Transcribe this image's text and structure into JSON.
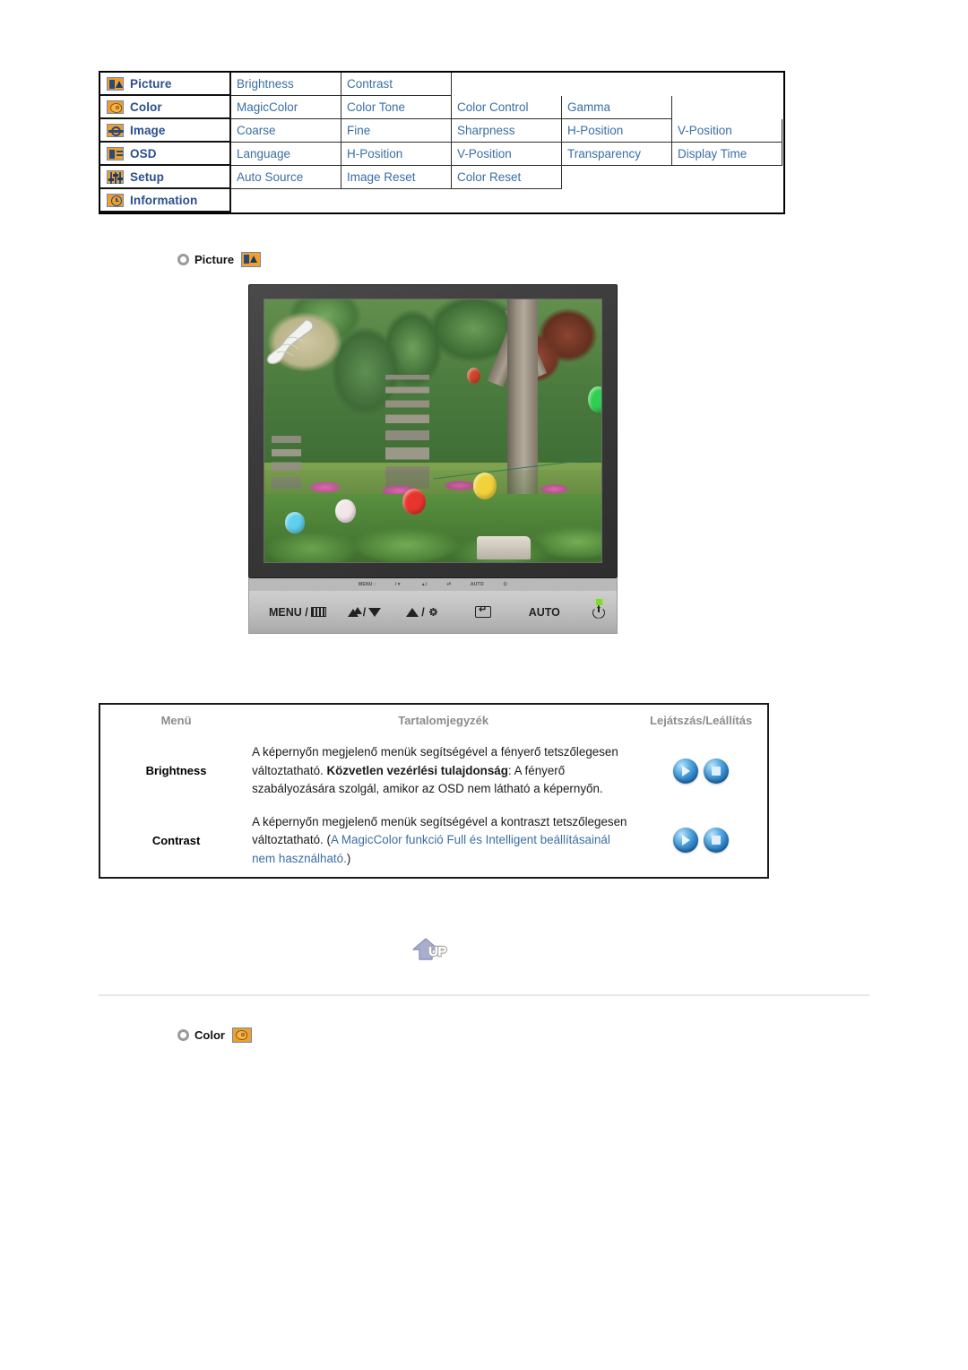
{
  "menu_map": {
    "rows": [
      {
        "icon": "picture-icon",
        "category": "Picture",
        "items": [
          "Brightness",
          "Contrast"
        ]
      },
      {
        "icon": "color-icon",
        "category": "Color",
        "items": [
          "MagicColor",
          "Color Tone",
          "Color Control",
          "Gamma"
        ]
      },
      {
        "icon": "image-icon",
        "category": "Image",
        "items": [
          "Coarse",
          "Fine",
          "Sharpness",
          "H-Position",
          "V-Position"
        ]
      },
      {
        "icon": "osd-icon",
        "category": "OSD",
        "items": [
          "Language",
          "H-Position",
          "V-Position",
          "Transparency",
          "Display Time"
        ]
      },
      {
        "icon": "setup-icon",
        "category": "Setup",
        "items": [
          "Auto Source",
          "Image Reset",
          "Color Reset"
        ]
      },
      {
        "icon": "information-icon",
        "category": "Information",
        "items": []
      }
    ]
  },
  "sections": {
    "picture": {
      "title": "Picture",
      "badge": "picture-icon"
    },
    "color": {
      "title": "Color",
      "badge": "color-icon"
    }
  },
  "monitor": {
    "hint_strip": [
      "MENU /",
      "/",
      "/",
      "",
      "AUTO",
      ""
    ],
    "buttons": [
      {
        "name": "menu-button",
        "label": "MENU /"
      },
      {
        "name": "magicbright-down-button",
        "label": "/"
      },
      {
        "name": "up-brightness-button",
        "label": "/"
      },
      {
        "name": "enter-button",
        "label": ""
      },
      {
        "name": "auto-button",
        "label": "AUTO"
      },
      {
        "name": "power-button",
        "label": ""
      }
    ],
    "auto_label": "AUTO",
    "menu_label": "MENU /",
    "slash": "/"
  },
  "detail_table": {
    "headers": {
      "menu": "Menü",
      "contents": "Tartalomjegyzék",
      "playstop": "Lejátszás/Leállítás"
    },
    "rows": [
      {
        "name": "Brightness",
        "desc_line1": "A képernyőn megjelenő menük segítségével a fényerő",
        "desc_line2": "tetszőlegesen változtatható.",
        "desc_bold": "Közvetlen vezérlési tulajdonság",
        "desc_line3": ": A fényerő",
        "desc_line4": "szabályozására szolgál, amikor az OSD nem látható a",
        "desc_line5": "képernyőn.",
        "note_open": "",
        "note": "",
        "note_close": ""
      },
      {
        "name": "Contrast",
        "desc_line1": "A képernyőn megjelenő menük segítségével a",
        "desc_line2": "kontraszt tetszőlegesen változtatható.",
        "desc_bold": "",
        "desc_line3": "",
        "desc_line4": "",
        "desc_line5": "",
        "note_open": "(",
        "note": "A MagicColor funkció Full és Intelligent beállításainál nem használható.",
        "note_close": ")"
      }
    ],
    "control_buttons": [
      "play-button",
      "stop-button"
    ]
  },
  "up_button": {
    "label": "UP",
    "icon": "up-arrow-icon"
  },
  "colors": {
    "menu_item_text": "#3a6ea5",
    "category_text": "#2a4f8f",
    "header_text": "#8c8c8c",
    "icon_tile": "#f0a02a",
    "button_blue": "#2a7fc4",
    "divider": "#e6e6e6"
  }
}
